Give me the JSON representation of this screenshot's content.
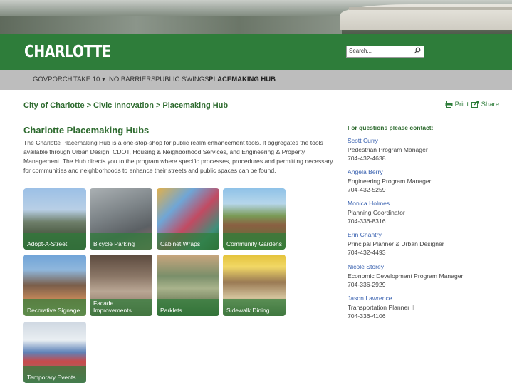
{
  "header": {
    "logo_text": "CHARLOTTE",
    "search_placeholder": "Search..."
  },
  "nav": {
    "items": [
      {
        "label": "GOVPORCH"
      },
      {
        "label": "TAKE 10 ▾"
      },
      {
        "label": "NO BARRIERS"
      },
      {
        "label": "PUBLIC SWINGS"
      },
      {
        "label": "PLACEMAKING HUB",
        "active": true
      }
    ]
  },
  "breadcrumb": {
    "items": [
      "City of Charlotte",
      "Civic Innovation",
      "Placemaking Hub"
    ],
    "separator": ">"
  },
  "tools": {
    "print_label": "Print",
    "share_label": "Share"
  },
  "main": {
    "title": "Charlotte Placemaking Hubs",
    "intro": "The Charlotte Placemaking Hub is a one-stop-shop for public realm enhancement tools. It aggregates the tools available through Urban Design, CDOT, Housing & Neighborhood Services, and Engineering & Property Management. The Hub directs you to the program where specific processes, procedures and permitting necessary for communities and neighborhoods to enhance their streets and public spaces can be found.",
    "tiles": [
      {
        "label": "Adopt-A-Street"
      },
      {
        "label": "Bicycle Parking"
      },
      {
        "label": "Cabinet Wraps"
      },
      {
        "label": "Community Gardens"
      },
      {
        "label": "Decorative Signage"
      },
      {
        "label": "Facade Improvements"
      },
      {
        "label": "Parklets"
      },
      {
        "label": "Sidewalk Dining"
      },
      {
        "label": "Temporary Events"
      }
    ]
  },
  "sidebar": {
    "heading": "For questions please contact:",
    "contacts": [
      {
        "name": "Scott Curry",
        "title": "Pedestrian Program Manager",
        "phone": "704-432-4638"
      },
      {
        "name": "Angela Berry",
        "title": "Engineering Program Manager",
        "phone": "704-432-5259"
      },
      {
        "name": "Monica Holmes",
        "title": "Planning Coordinator",
        "phone": "704-336-8316"
      },
      {
        "name": "Erin Chantry",
        "title": "Principal Planner & Urban Designer",
        "phone": "704-432-4493"
      },
      {
        "name": "Nicole Storey",
        "title": "Economic Development Program Manager",
        "phone": "704-336-2929"
      },
      {
        "name": "Jason Lawrence",
        "title": "Transportation Planner II",
        "phone": "704-336-4106"
      }
    ]
  },
  "colors": {
    "brand_green": "#2e7d3a",
    "nav_gray": "#bdbdbd",
    "link_blue": "#3a62b0"
  }
}
